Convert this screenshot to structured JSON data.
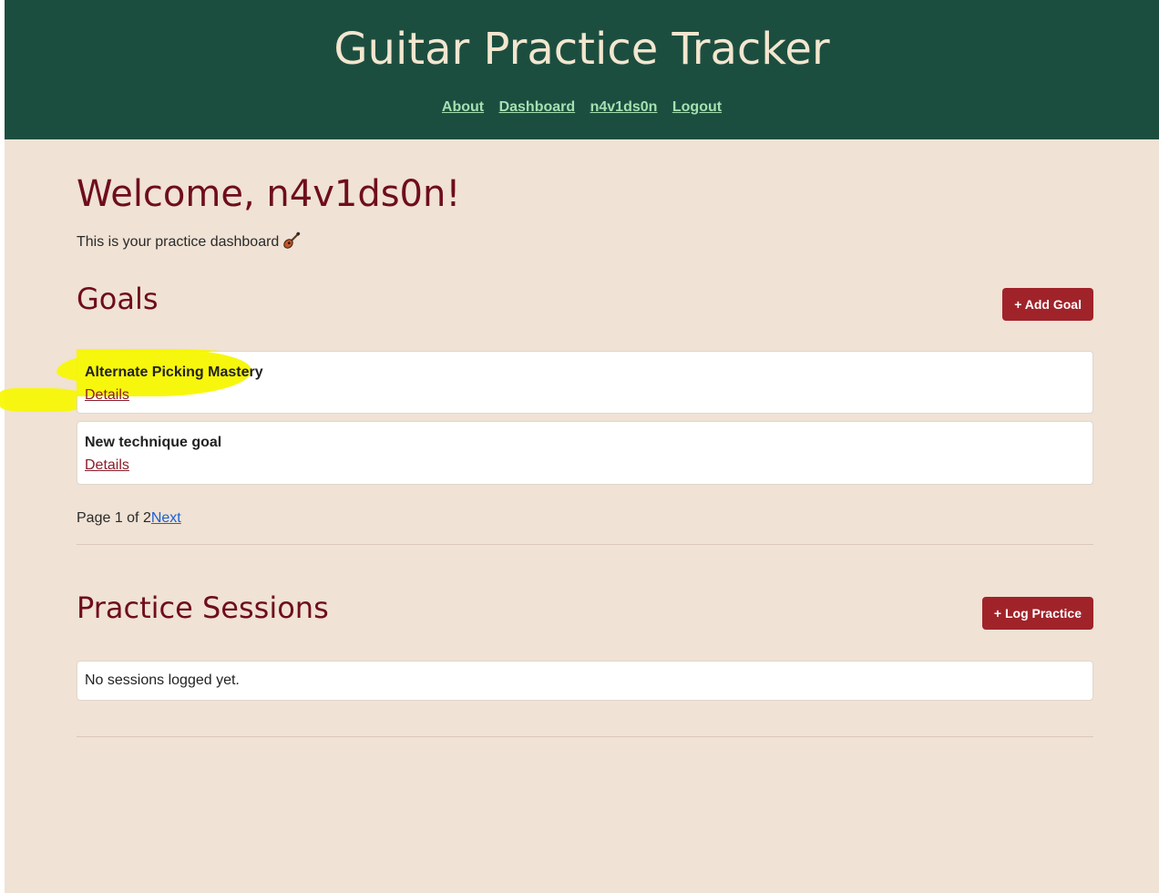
{
  "header": {
    "title": "Guitar Practice Tracker",
    "nav": [
      {
        "label": "About"
      },
      {
        "label": "Dashboard"
      },
      {
        "label": "n4v1ds0n"
      },
      {
        "label": "Logout"
      }
    ]
  },
  "main": {
    "welcome": "Welcome, n4v1ds0n!",
    "subtitle": "This is your practice dashboard",
    "subtitle_icon": "guitar-icon",
    "goals": {
      "title": "Goals",
      "add_button": "+ Add Goal",
      "items": [
        {
          "title": "Alternate Picking Mastery",
          "link": "Details",
          "highlighted": true
        },
        {
          "title": "New technique goal",
          "link": "Details",
          "highlighted": false
        }
      ],
      "pagination": {
        "text": "Page 1 of 2",
        "next": "Next"
      }
    },
    "sessions": {
      "title": "Practice Sessions",
      "log_button": "+ Log Practice",
      "empty_text": "No sessions logged yet."
    }
  },
  "colors": {
    "header_bg": "#1c4e40",
    "page_bg": "#f0e2d4",
    "accent": "#a0232a",
    "heading": "#6e0d1e",
    "nav_link": "#a5e0b1",
    "highlight": "#f7f700"
  }
}
